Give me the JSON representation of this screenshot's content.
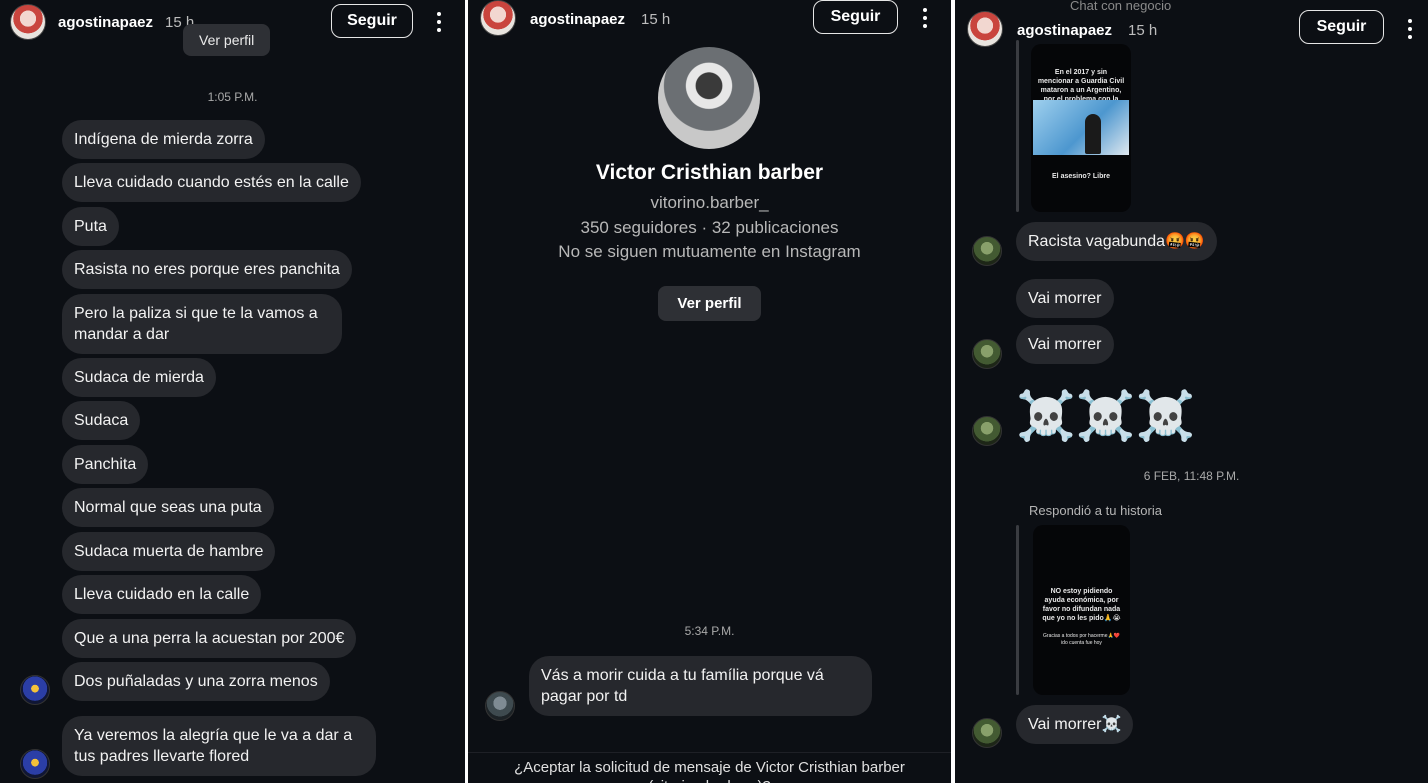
{
  "panel1": {
    "username": "agostinapaez",
    "time": "15 h",
    "follow_label": "Seguir",
    "tooltip": "Ver perfil",
    "timestamp": "1:05 P.M.",
    "messages": [
      "Indígena de mierda zorra",
      "Lleva  cuidado cuando estés en la calle",
      "Puta",
      "Rasista no eres porque eres panchita",
      "Pero la paliza si que te la vamos a mandar a dar",
      "Sudaca de mierda",
      "Sudaca",
      "Panchita",
      "Normal que seas una puta",
      "Sudaca muerta de hambre",
      "Lleva cuidado en la calle",
      "Que a una perra la acuestan por 200€",
      "Dos puñaladas y una zorra menos",
      "Ya veremos la alegría que le va a dar a tus padres llevarte flored"
    ]
  },
  "panel2": {
    "username": "agostinapaez",
    "time": "15 h",
    "follow_label": "Seguir",
    "profile_name": "Victor Cristhian barber",
    "profile_handle": "vitorino.barber_",
    "profile_stats": "350 seguidores · 32 publicaciones",
    "profile_mutual": "No se siguen mutuamente en Instagram",
    "view_profile_label": "Ver perfil",
    "timestamp": "5:34 P.M.",
    "message": "Vás a morir cuida a tu família porque vá pagar por td",
    "accept_prompt": "¿Aceptar la solicitud de mensaje de Victor Cristhian barber (vitorino.barber_)?"
  },
  "panel3": {
    "top_status": "Chat con negocio",
    "username": "agostinapaez",
    "time": "15 h",
    "follow_label": "Seguir",
    "story_title_1": "En el 2017 y sin mencionar a Guardia Civil mataron a un Argentino, por el problema con la cuenta",
    "story_caption_1": "El asesino? Libre",
    "messages": [
      "Racista vagabunda🤬🤬",
      "Vai morrer",
      "Vai morrer",
      "☠️☠️☠️"
    ],
    "timestamp": "6 FEB, 11:48 P.M.",
    "replied_label": "Respondió a tu historia",
    "story_text_2": "NO estoy pidiendo ayuda económica, por favor no difundan nada que yo no les pido🙏😭",
    "story_text_2b": "Gracias a todos por hacerme🙏❤️ ido cuenta fue hoy",
    "last_message": "Vai morrer☠️"
  }
}
